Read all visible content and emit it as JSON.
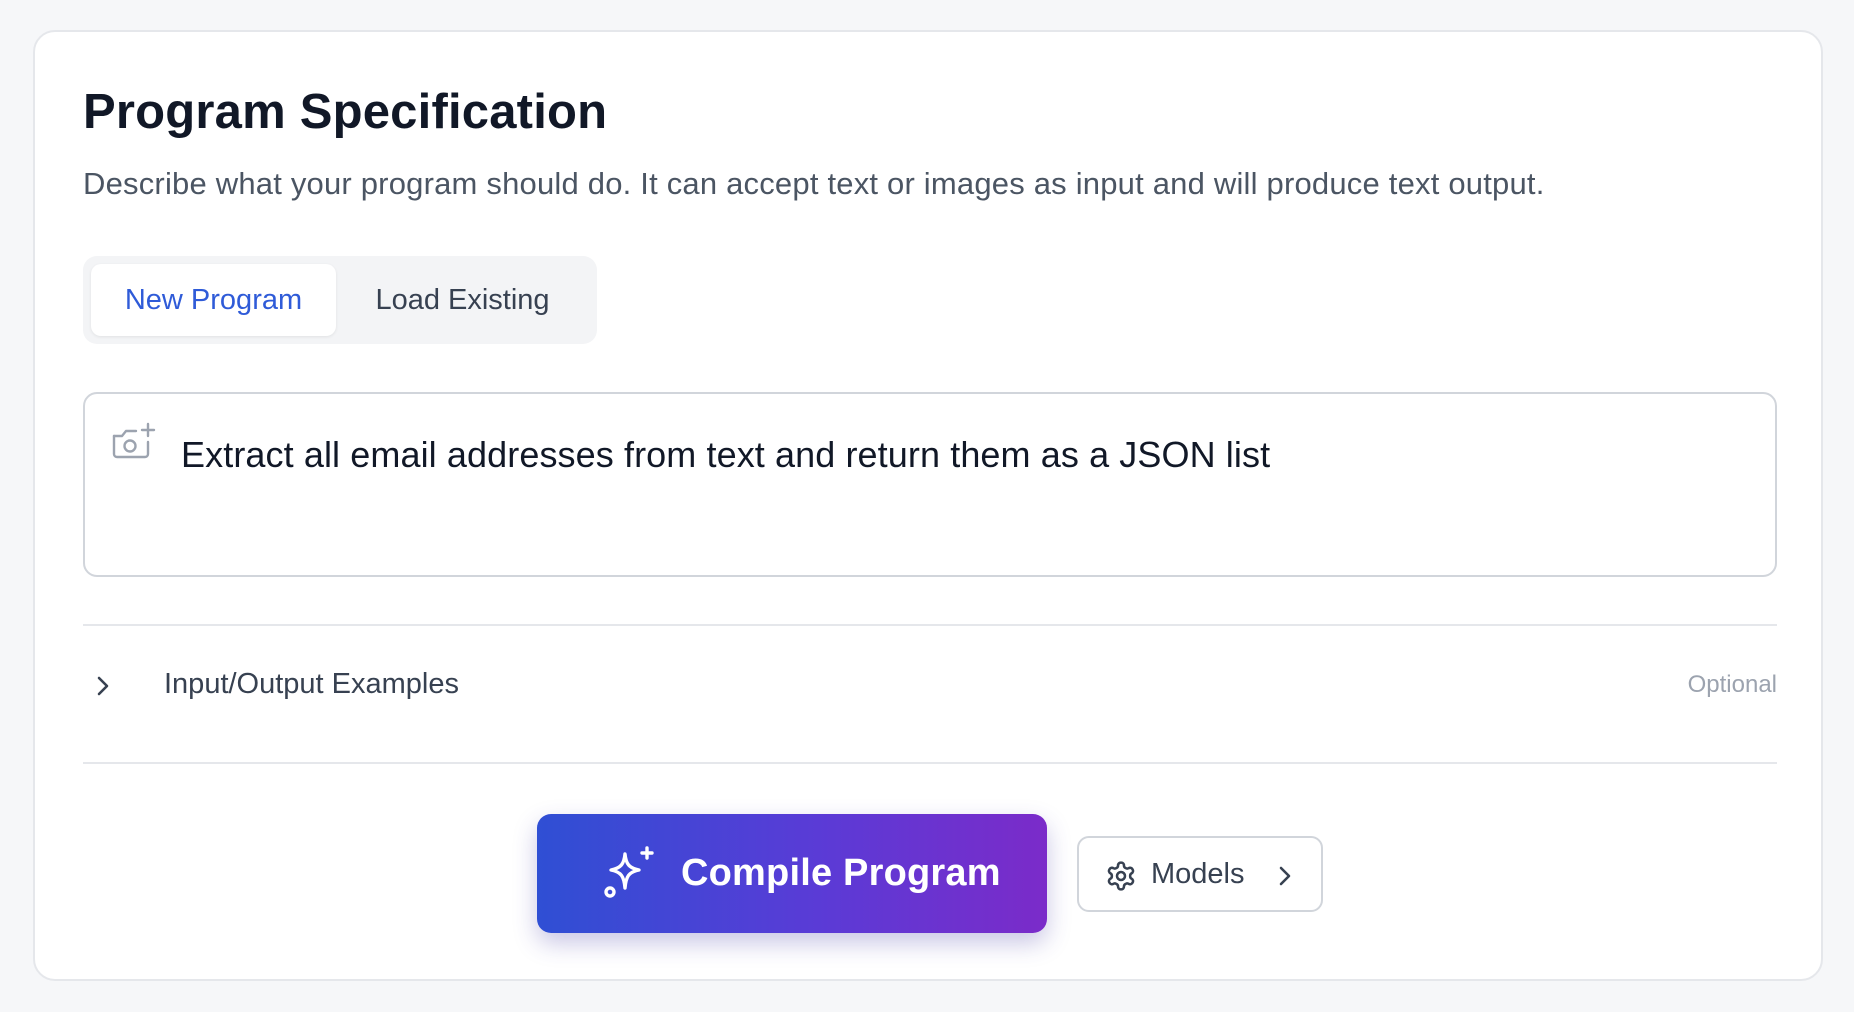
{
  "header": {
    "title": "Program Specification",
    "subtitle": "Describe what your program should do. It can accept text or images as input and will produce text output."
  },
  "tabs": [
    {
      "label": "New Program",
      "active": true
    },
    {
      "label": "Load Existing",
      "active": false
    }
  ],
  "prompt": {
    "value": "Extract all email addresses from text and return them as a JSON list",
    "icon": "camera-plus-icon"
  },
  "examples": {
    "label": "Input/Output Examples",
    "badge": "Optional",
    "expanded": false,
    "icon": "chevron-right-icon"
  },
  "actions": {
    "compile_label": "Compile Program",
    "compile_icon": "sparkles-icon",
    "models_label": "Models",
    "models_icon": "gear-icon"
  },
  "colors": {
    "accent": "#2f5bd8",
    "gradient_start": "#2f4fd4",
    "gradient_end": "#7b2bc9"
  }
}
